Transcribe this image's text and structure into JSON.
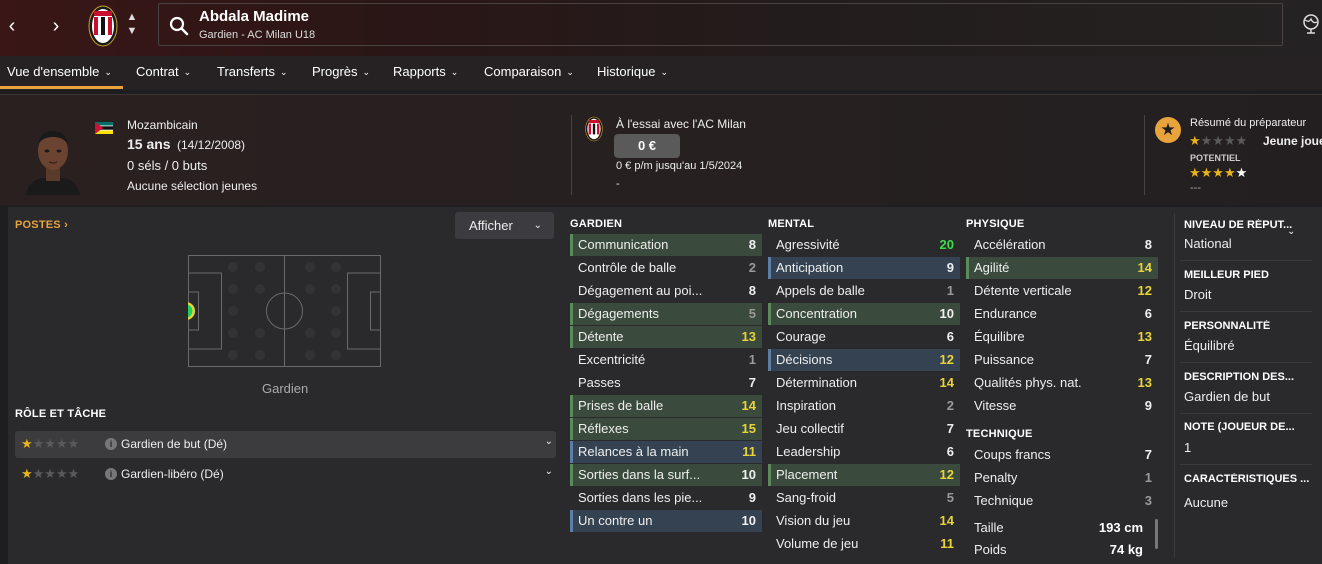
{
  "topbar": {
    "player_name": "Abdala Madime",
    "player_subtitle": "Gardien - AC Milan U18"
  },
  "menu": [
    "Vue d'ensemble",
    "Contrat",
    "Transferts",
    "Progrès",
    "Rapports",
    "Comparaison",
    "Historique"
  ],
  "header": {
    "nationality": "Mozambicain",
    "age": "15 ans",
    "birth_date": "(14/12/2008)",
    "caps": "0 séls / 0 buts",
    "youth_selection": "Aucune sélection jeunes",
    "trial": "À l'essai avec l'AC Milan",
    "value": "0 €",
    "wage": "0 € p/m jusqu'au 1/5/2024",
    "wage_extra": "-",
    "coach_report_title": "Résumé du préparateur",
    "coach_report_text": "Jeune joueur",
    "current_ability_stars": 1,
    "potential_label": "POTENTIEL",
    "potential_stars": 4.5,
    "potential_dash": "---"
  },
  "positions": {
    "title": "POSTES",
    "show_button": "Afficher",
    "current_position": "Gardien"
  },
  "roles": {
    "title": "RÔLE ET TÂCHE",
    "items": [
      {
        "label": "Gardien de but (Dé)",
        "stars": 1
      },
      {
        "label": "Gardien-libéro (Dé)",
        "stars": 1
      }
    ]
  },
  "gardien": {
    "title": "GARDIEN",
    "attributes": [
      {
        "name": "Communication",
        "value": "8",
        "hl": "green"
      },
      {
        "name": "Contrôle de balle",
        "value": "2",
        "hl": ""
      },
      {
        "name": "Dégagement au poi...",
        "value": "8",
        "hl": ""
      },
      {
        "name": "Dégagements",
        "value": "5",
        "hl": "green"
      },
      {
        "name": "Détente",
        "value": "13",
        "hl": "green"
      },
      {
        "name": "Excentricité",
        "value": "1",
        "hl": ""
      },
      {
        "name": "Passes",
        "value": "7",
        "hl": ""
      },
      {
        "name": "Prises de balle",
        "value": "14",
        "hl": "green"
      },
      {
        "name": "Réflexes",
        "value": "15",
        "hl": "green"
      },
      {
        "name": "Relances à la main",
        "value": "11",
        "hl": "blue"
      },
      {
        "name": "Sorties dans la surf...",
        "value": "10",
        "hl": "green"
      },
      {
        "name": "Sorties dans les pie...",
        "value": "9",
        "hl": ""
      },
      {
        "name": "Un contre un",
        "value": "10",
        "hl": "blue"
      }
    ]
  },
  "mental": {
    "title": "MENTAL",
    "attributes": [
      {
        "name": "Agressivité",
        "value": "20",
        "hl": ""
      },
      {
        "name": "Anticipation",
        "value": "9",
        "hl": "blue"
      },
      {
        "name": "Appels de balle",
        "value": "1",
        "hl": ""
      },
      {
        "name": "Concentration",
        "value": "10",
        "hl": "green"
      },
      {
        "name": "Courage",
        "value": "6",
        "hl": ""
      },
      {
        "name": "Décisions",
        "value": "12",
        "hl": "blue"
      },
      {
        "name": "Détermination",
        "value": "14",
        "hl": ""
      },
      {
        "name": "Inspiration",
        "value": "2",
        "hl": ""
      },
      {
        "name": "Jeu collectif",
        "value": "7",
        "hl": ""
      },
      {
        "name": "Leadership",
        "value": "6",
        "hl": ""
      },
      {
        "name": "Placement",
        "value": "12",
        "hl": "green"
      },
      {
        "name": "Sang-froid",
        "value": "5",
        "hl": ""
      },
      {
        "name": "Vision du jeu",
        "value": "14",
        "hl": ""
      },
      {
        "name": "Volume de jeu",
        "value": "11",
        "hl": ""
      }
    ]
  },
  "physique": {
    "title": "PHYSIQUE",
    "attributes": [
      {
        "name": "Accélération",
        "value": "8",
        "hl": ""
      },
      {
        "name": "Agilité",
        "value": "14",
        "hl": "green"
      },
      {
        "name": "Détente verticale",
        "value": "12",
        "hl": ""
      },
      {
        "name": "Endurance",
        "value": "6",
        "hl": ""
      },
      {
        "name": "Équilibre",
        "value": "13",
        "hl": ""
      },
      {
        "name": "Puissance",
        "value": "7",
        "hl": ""
      },
      {
        "name": "Qualités phys. nat.",
        "value": "13",
        "hl": ""
      },
      {
        "name": "Vitesse",
        "value": "9",
        "hl": ""
      }
    ]
  },
  "technique": {
    "title": "TECHNIQUE",
    "attributes": [
      {
        "name": "Coups francs",
        "value": "7",
        "hl": ""
      },
      {
        "name": "Penalty",
        "value": "1",
        "hl": ""
      },
      {
        "name": "Technique",
        "value": "3",
        "hl": ""
      }
    ]
  },
  "body": {
    "height_label": "Taille",
    "height_value": "193 cm",
    "weight_label": "Poids",
    "weight_value": "74 kg"
  },
  "info": [
    {
      "title": "NIVEAU DE RÉPUT...",
      "value": "National"
    },
    {
      "title": "MEILLEUR PIED",
      "value": "Droit"
    },
    {
      "title": "PERSONNALITÉ",
      "value": "Équilibré"
    },
    {
      "title": "DESCRIPTION DES...",
      "value": "Gardien de but"
    },
    {
      "title": "NOTE (JOUEUR DE...",
      "value": "1"
    },
    {
      "title": "CARACTÉRISTIQUES ...",
      "value": "Aucune"
    }
  ],
  "colors": {
    "accent": "#e8a33d",
    "club_red": "#c8102e",
    "highlight_green": "#3a4a3c",
    "highlight_blue": "#344252",
    "value_yellow": "#e8d43a",
    "value_green": "#3ddc4a"
  }
}
